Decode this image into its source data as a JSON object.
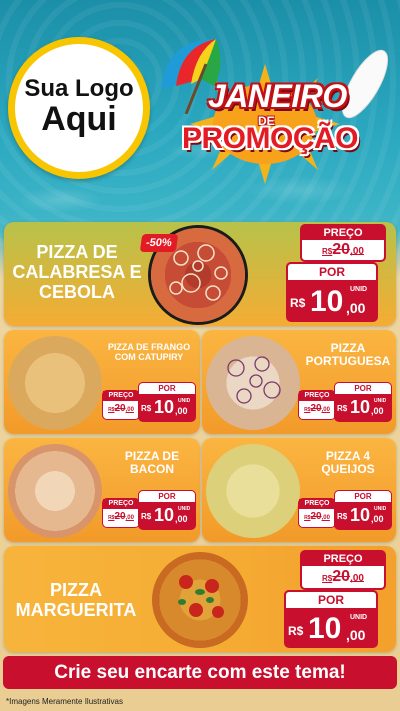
{
  "logo": {
    "line1": "Sua Logo",
    "line2": "Aqui"
  },
  "headline": {
    "line1": "JANEIRO",
    "line2": "DE",
    "line3": "PROMOÇÃO"
  },
  "discount_badge": "-50%",
  "labels": {
    "preco": "PREÇO",
    "por": "POR",
    "currency": "R$",
    "unit": "UNID"
  },
  "products": [
    {
      "name": "PIZZA DE CALABRESA E CEBOLA",
      "old_price_int": "20",
      "old_price_dec": ",00",
      "price_int": "10",
      "price_dec": ",00"
    },
    {
      "name": "PIZZA DE FRANGO COM CATUPIRY",
      "old_price_int": "20",
      "old_price_dec": ",00",
      "price_int": "10",
      "price_dec": ",00"
    },
    {
      "name": "PIZZA PORTUGUESA",
      "old_price_int": "20",
      "old_price_dec": ",00",
      "price_int": "10",
      "price_dec": ",00"
    },
    {
      "name": "PIZZA DE BACON",
      "old_price_int": "20",
      "old_price_dec": ",00",
      "price_int": "10",
      "price_dec": ",00"
    },
    {
      "name": "PIZZA 4 QUEIJOS",
      "old_price_int": "20",
      "old_price_dec": ",00",
      "price_int": "10",
      "price_dec": ",00"
    },
    {
      "name": "PIZZA MARGUERITA",
      "old_price_int": "20",
      "old_price_dec": ",00",
      "price_int": "10",
      "price_dec": ",00"
    }
  ],
  "cta": "Crie seu encarte com este tema!",
  "disclaimer": "*Imagens Meramente Ilustrativas",
  "colors": {
    "red": "#c8102e",
    "orange": "#f6ae35",
    "yellow": "#f7c600"
  }
}
